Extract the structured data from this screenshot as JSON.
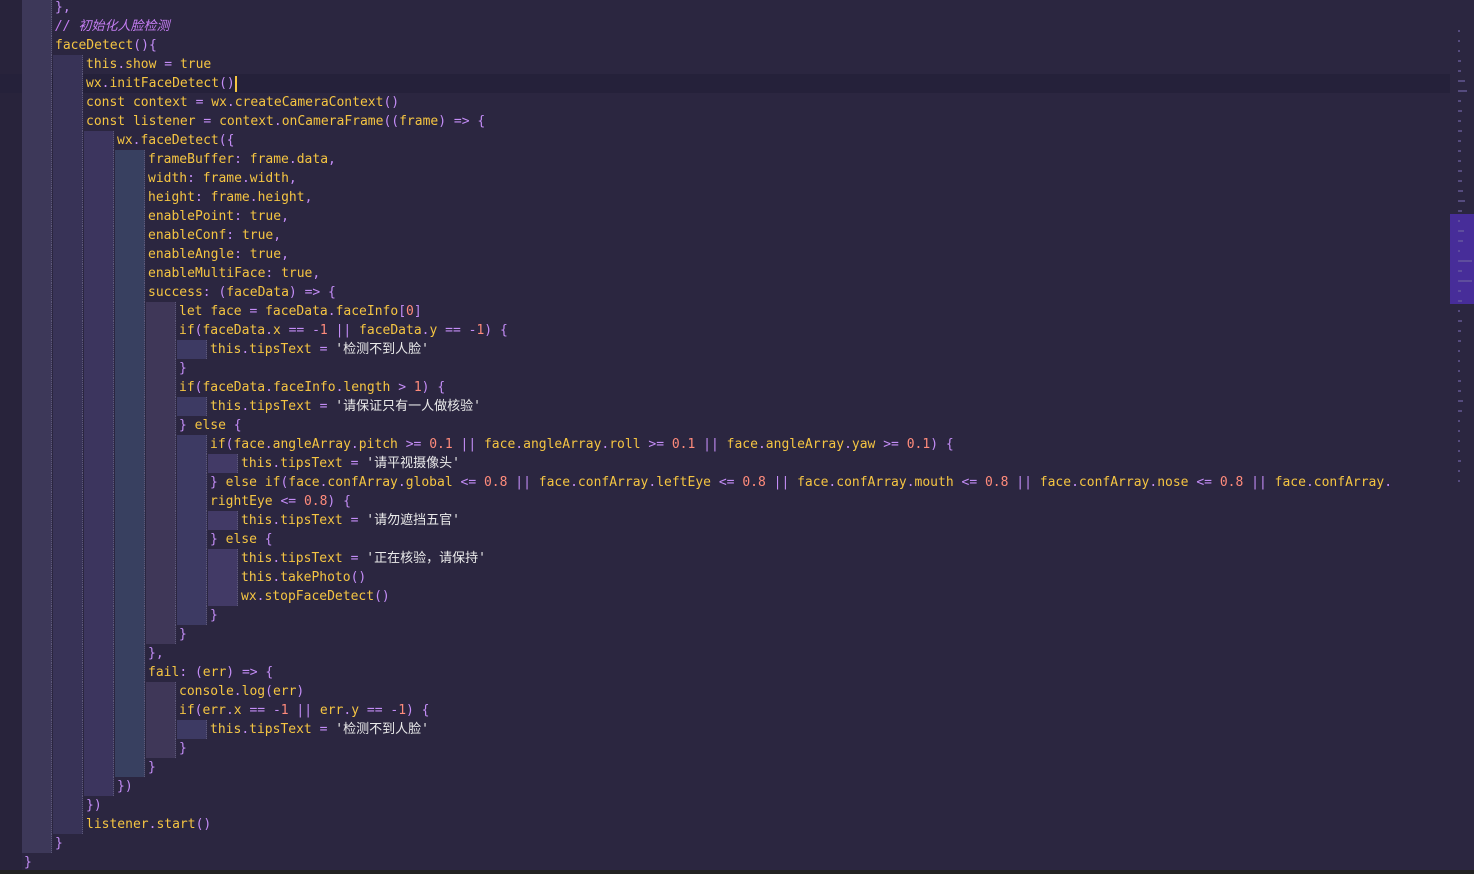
{
  "editor": {
    "language": "javascript",
    "cursor_line": 5,
    "lines": [
      {
        "text": "},",
        "indent": 2,
        "type": "plain"
      },
      {
        "text": "// 初始化人脸检测",
        "indent": 2,
        "type": "comment"
      },
      {
        "text": "faceDetect(){",
        "indent": 2,
        "type": "code"
      },
      {
        "text": "this.show = true",
        "indent": 3,
        "type": "code"
      },
      {
        "text": "wx.initFaceDetect()",
        "indent": 3,
        "type": "code",
        "cursor": true
      },
      {
        "text": "const context = wx.createCameraContext()",
        "indent": 3,
        "type": "code"
      },
      {
        "text": "const listener = context.onCameraFrame((frame) => {",
        "indent": 3,
        "type": "code"
      },
      {
        "text": "wx.faceDetect({",
        "indent": 4,
        "type": "code"
      },
      {
        "text": "frameBuffer: frame.data,",
        "indent": 5,
        "type": "code"
      },
      {
        "text": "width: frame.width,",
        "indent": 5,
        "type": "code"
      },
      {
        "text": "height: frame.height,",
        "indent": 5,
        "type": "code"
      },
      {
        "text": "enablePoint: true,",
        "indent": 5,
        "type": "code"
      },
      {
        "text": "enableConf: true,",
        "indent": 5,
        "type": "code"
      },
      {
        "text": "enableAngle: true,",
        "indent": 5,
        "type": "code"
      },
      {
        "text": "enableMultiFace: true,",
        "indent": 5,
        "type": "code"
      },
      {
        "text": "success: (faceData) => {",
        "indent": 5,
        "type": "code"
      },
      {
        "text": "let face = faceData.faceInfo[0]",
        "indent": 6,
        "type": "code"
      },
      {
        "text": "if(faceData.x == -1 || faceData.y == -1) {",
        "indent": 6,
        "type": "code"
      },
      {
        "text": "this.tipsText = '检测不到人脸'",
        "indent": 7,
        "type": "code"
      },
      {
        "text": "}",
        "indent": 6,
        "type": "code"
      },
      {
        "text": "if(faceData.faceInfo.length > 1) {",
        "indent": 6,
        "type": "code"
      },
      {
        "text": "this.tipsText = '请保证只有一人做核验'",
        "indent": 7,
        "type": "code"
      },
      {
        "text": "} else {",
        "indent": 6,
        "type": "code"
      },
      {
        "text": "if(face.angleArray.pitch >= 0.1 || face.angleArray.roll >= 0.1 || face.angleArray.yaw >= 0.1) {",
        "indent": 7,
        "type": "code"
      },
      {
        "text": "this.tipsText = '请平视摄像头'",
        "indent": 8,
        "type": "code"
      },
      {
        "text": "} else if(face.confArray.global <= 0.8 || face.confArray.leftEye <= 0.8 || face.confArray.mouth <= 0.8 || face.confArray.nose <= 0.8 || face.confArray.",
        "indent": 7,
        "type": "code"
      },
      {
        "text": "rightEye <= 0.8) {",
        "indent": 7,
        "type": "code"
      },
      {
        "text": "this.tipsText = '请勿遮挡五官'",
        "indent": 8,
        "type": "code"
      },
      {
        "text": "} else {",
        "indent": 7,
        "type": "code"
      },
      {
        "text": "this.tipsText = '正在核验，请保持'",
        "indent": 8,
        "type": "code"
      },
      {
        "text": "this.takePhoto()",
        "indent": 8,
        "type": "code"
      },
      {
        "text": "wx.stopFaceDetect()",
        "indent": 8,
        "type": "code"
      },
      {
        "text": "}",
        "indent": 7,
        "type": "code"
      },
      {
        "text": "}",
        "indent": 6,
        "type": "code"
      },
      {
        "text": "},",
        "indent": 5,
        "type": "code"
      },
      {
        "text": "fail: (err) => {",
        "indent": 5,
        "type": "code"
      },
      {
        "text": "console.log(err)",
        "indent": 6,
        "type": "code"
      },
      {
        "text": "if(err.x == -1 || err.y == -1) {",
        "indent": 6,
        "type": "code"
      },
      {
        "text": "this.tipsText = '检测不到人脸'",
        "indent": 7,
        "type": "code"
      },
      {
        "text": "}",
        "indent": 6,
        "type": "code"
      },
      {
        "text": "}",
        "indent": 5,
        "type": "code"
      },
      {
        "text": "})",
        "indent": 4,
        "type": "code"
      },
      {
        "text": "})",
        "indent": 3,
        "type": "code"
      },
      {
        "text": "listener.start()",
        "indent": 3,
        "type": "code"
      },
      {
        "text": "}",
        "indent": 2,
        "type": "code"
      },
      {
        "text": "}",
        "indent": 1,
        "type": "code"
      }
    ]
  },
  "colors": {
    "background": "#2b2640",
    "keyword": "#f5c542",
    "comment": "#c57df2",
    "number": "#ff8b7b",
    "operator": "#c48df7",
    "text": "#e6e6e6"
  }
}
